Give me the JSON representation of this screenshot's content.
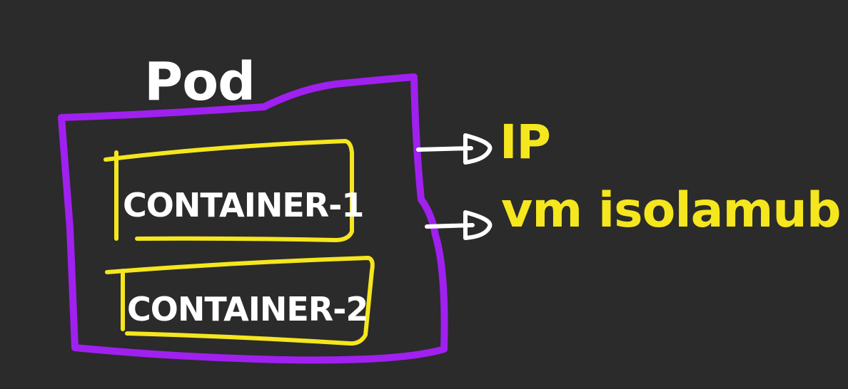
{
  "colors": {
    "background": "#2b2b2b",
    "pod_outline": "#a020f0",
    "container_outline": "#f5e61e",
    "label_white": "#ffffff",
    "annotation_yellow": "#f5e61e"
  },
  "pod": {
    "label": "Pod"
  },
  "containers": [
    {
      "label": "CONTAINER-1"
    },
    {
      "label": "CONTAINER-2"
    }
  ],
  "annotations": [
    {
      "label": "IP"
    },
    {
      "label": "vm isolamub"
    }
  ]
}
